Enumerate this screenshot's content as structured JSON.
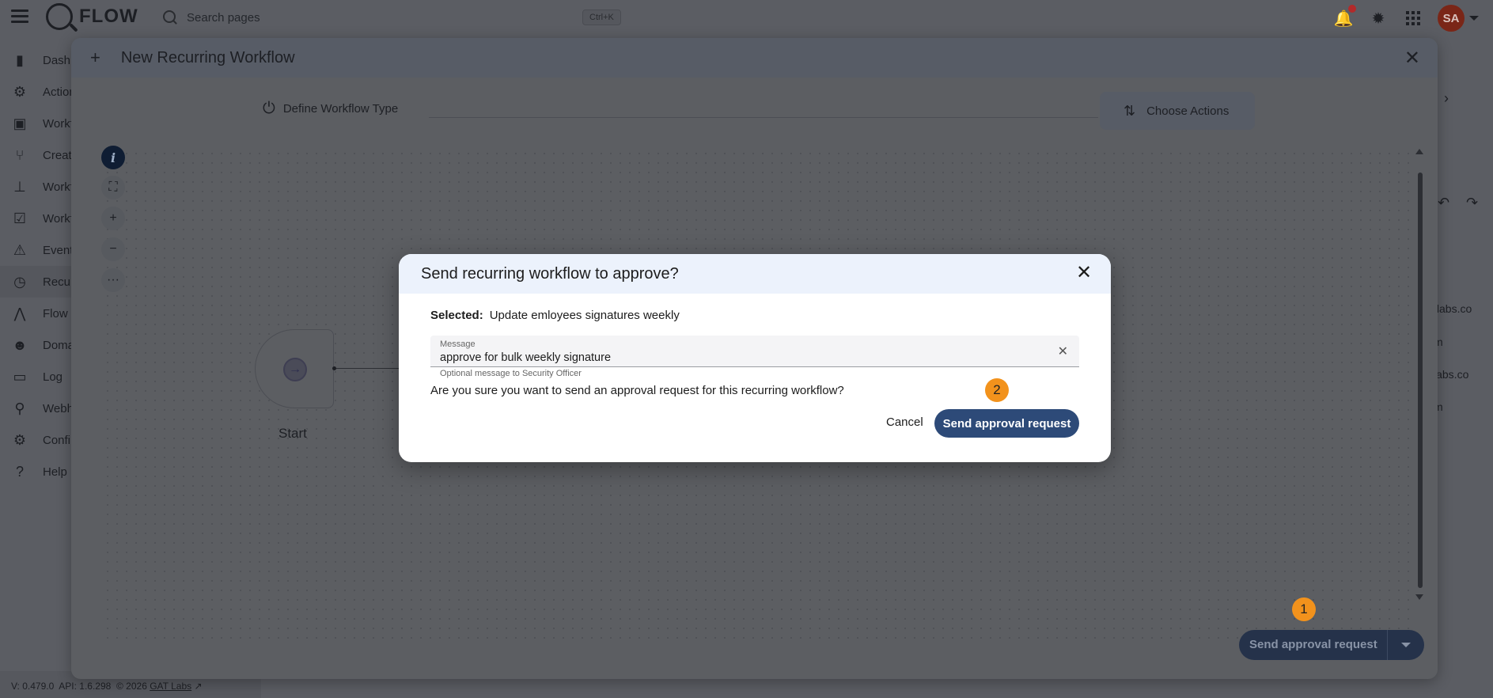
{
  "app": {
    "name": "FLOW"
  },
  "search": {
    "placeholder": "Search pages",
    "shortcut": "Ctrl+K"
  },
  "user": {
    "initials": "SA"
  },
  "sidebar": {
    "items": [
      {
        "label": "Dashb",
        "icon": "bar-chart-icon"
      },
      {
        "label": "Action",
        "icon": "gears-icon"
      },
      {
        "label": "Workf",
        "icon": "code-window-icon"
      },
      {
        "label": "Creat",
        "icon": "fork-icon"
      },
      {
        "label": "Workf",
        "icon": "hierarchy-icon"
      },
      {
        "label": "Workf",
        "icon": "checklist-icon"
      },
      {
        "label": "Event",
        "icon": "alarm-icon"
      },
      {
        "label": "Recur",
        "icon": "clock-icon"
      },
      {
        "label": "Flow",
        "icon": "flow-icon"
      },
      {
        "label": "Doma",
        "icon": "people-icon"
      },
      {
        "label": "Log",
        "icon": "log-icon"
      },
      {
        "label": "Webh",
        "icon": "webhook-icon"
      },
      {
        "label": "Confi",
        "icon": "gear-icon"
      },
      {
        "label": "Help",
        "icon": "help-icon"
      }
    ]
  },
  "footer": {
    "version": "V: 0.479.0",
    "api": "API: 1.6.298",
    "copyright": "© 2026",
    "company": "GAT Labs"
  },
  "background_fragments": [
    "tlabs.co",
    "m",
    "labs.co",
    "m"
  ],
  "main_modal": {
    "title": "New Recurring Workflow",
    "steps": [
      "Define Workflow Type",
      "Choose Actions"
    ],
    "start_node_label": "Start",
    "send_button": "Send approval request",
    "badge_1": "1"
  },
  "dialog": {
    "title": "Send recurring workflow to approve?",
    "selected_label": "Selected:",
    "selected_value": "Update emloyees signatures weekly",
    "message_label": "Message",
    "message_value": "approve for bulk weekly signature",
    "message_helper": "Optional message to Security Officer",
    "question": "Are you sure you want to send an approval request for this recurring workflow?",
    "cancel_label": "Cancel",
    "confirm_label": "Send approval request",
    "badge_2": "2"
  }
}
